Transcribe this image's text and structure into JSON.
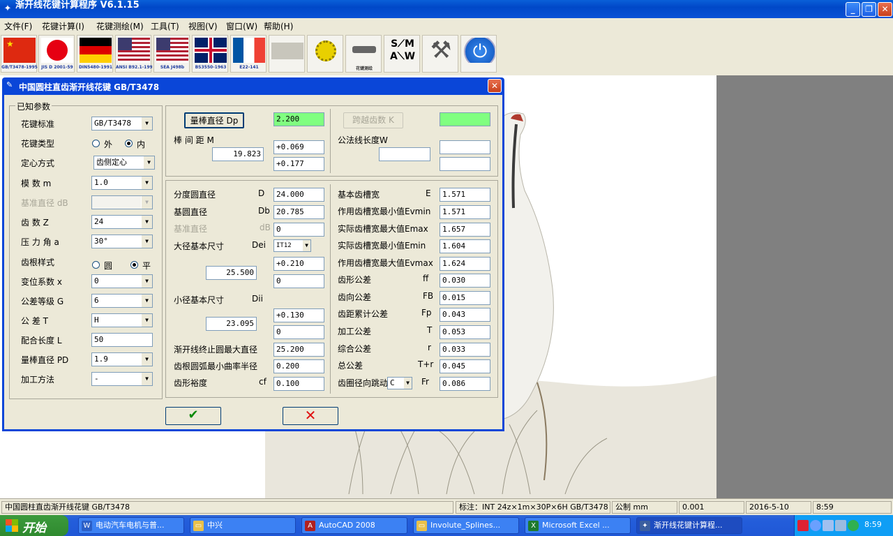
{
  "window": {
    "title": "渐开线花键计算程序      V6.1.15",
    "min": "_",
    "max": "❐",
    "close": "✕"
  },
  "menu": [
    "文件(F)",
    "花键计算(I)",
    "花键测绘(M)",
    "工具(T)",
    "视图(V)",
    "窗口(W)",
    "帮助(H)"
  ],
  "toolbar": [
    {
      "caption": "GB/T3478-1995",
      "icon": "china-flag-icon"
    },
    {
      "caption": "JIS D 2001-59",
      "icon": "japan-flag-icon"
    },
    {
      "caption": "DIN5480-1991",
      "icon": "germany-flag-icon"
    },
    {
      "caption": "ANSI B92.1-1996",
      "icon": "usa-flag-icon"
    },
    {
      "caption": "SEA J498b",
      "icon": "usa-flag-icon"
    },
    {
      "caption": "BS3550-1963",
      "icon": "uk-flag-icon"
    },
    {
      "caption": "E22-141",
      "icon": "france-flag-icon"
    },
    {
      "caption": "",
      "icon": "disabled-tool-icon"
    },
    {
      "caption": "",
      "icon": "gear-puzzle-icon"
    },
    {
      "caption": "花键测绘",
      "icon": "measure-icon"
    },
    {
      "caption": "",
      "icon": "sam-logo-icon"
    },
    {
      "caption": "",
      "icon": "tools-icon"
    },
    {
      "caption": "",
      "icon": "power-icon"
    }
  ],
  "dialog": {
    "title": "中国圆柱直齿渐开线花键   GB/T3478",
    "close": "✕",
    "known_group": "已知参数",
    "params": [
      {
        "label": "花键标准",
        "value": "GB/T3478",
        "type": "combo"
      },
      {
        "label": "花键类型",
        "type": "radio",
        "options": [
          "外",
          "内"
        ],
        "selected": 1
      },
      {
        "label": "定心方式",
        "value": "齿侧定心",
        "type": "combo"
      },
      {
        "label": "模    数  m",
        "value": "1.0",
        "type": "combo"
      },
      {
        "label": "基准直径 dB",
        "value": "",
        "type": "combo",
        "disabled": true
      },
      {
        "label": "齿    数  Z",
        "value": "24",
        "type": "combo"
      },
      {
        "label": "压 力 角  a",
        "value": "30°",
        "type": "combo"
      },
      {
        "label": "齿根样式",
        "type": "radio",
        "options": [
          "圆",
          "平"
        ],
        "selected": 1
      },
      {
        "label": "变位系数  x",
        "value": "0",
        "type": "combo"
      },
      {
        "label": "公差等级  G",
        "value": "6",
        "type": "combo"
      },
      {
        "label": " 公   差  T",
        "value": "H",
        "type": "combo"
      },
      {
        "label": "配合长度  L",
        "value": "50",
        "type": "text"
      },
      {
        "label": "量棒直径 PD",
        "value": "1.9",
        "type": "combo"
      },
      {
        "label": "加工方法",
        "value": "-",
        "type": "combo"
      }
    ],
    "top_left": {
      "btn": "量棒直径 Dp",
      "dp": "2.200",
      "m_label": "棒 间 距  M",
      "m_value": "19.823",
      "tol1": "+0.069",
      "tol2": "+0.177"
    },
    "top_right": {
      "btn": "跨越齿数  K",
      "w_label": "公法线长度W",
      "k_value": "",
      "w_value": "",
      "w_tol1": "",
      "w_tol2": ""
    },
    "mid_left": {
      "d_label": "分度圆直径",
      "d_sym": "D",
      "d_val": "24.000",
      "db_label": "基圆直径",
      "db_sym": "Db",
      "db_val": "20.785",
      "dbase_label": "基准直径",
      "dbase_sym": "dB",
      "dbase_val": "0",
      "dei_label": "大径基本尺寸",
      "dei_sym": "Dei",
      "dei_grade": "IT12",
      "dei_val": "25.500",
      "dei_tol1": "+0.210",
      "dei_tol2": "0",
      "dii_label": "小径基本尺寸",
      "dii_sym": "Dii",
      "dii_val": "23.095",
      "dii_tol1": "+0.130",
      "dii_tol2": "0",
      "dfmax_label": "渐开线终止圆最大直径",
      "dfmax_val": "25.200",
      "rho_label": "齿根圆弧最小曲率半径",
      "rho_val": "0.200",
      "cf_label": "齿形裕度",
      "cf_sym": "cf",
      "cf_val": "0.100"
    },
    "mid_right": [
      {
        "label": "基本齿槽宽",
        "sym": "E",
        "value": "1.571"
      },
      {
        "label": "作用齿槽宽最小值Evmin",
        "sym": "",
        "value": "1.571"
      },
      {
        "label": "实际齿槽宽最大值Emax",
        "sym": "",
        "value": "1.657"
      },
      {
        "label": "实际齿槽宽最小值Emin",
        "sym": "",
        "value": "1.604"
      },
      {
        "label": "作用齿槽宽最大值Evmax",
        "sym": "",
        "value": "1.624"
      },
      {
        "label": "齿形公差",
        "sym": "ff",
        "value": "0.030"
      },
      {
        "label": "齿向公差",
        "sym": "FB",
        "value": "0.015"
      },
      {
        "label": "齿距累计公差",
        "sym": "Fp",
        "value": "0.043"
      },
      {
        "label": "加工公差",
        "sym": "T",
        "value": "0.053"
      },
      {
        "label": "综合公差",
        "sym": "r",
        "value": "0.033"
      },
      {
        "label": "总公差",
        "sym": "T+r",
        "value": "0.045"
      },
      {
        "label": "齿圈径向跳动",
        "sym": "Fr",
        "value": "0.086",
        "combo": "C"
      }
    ],
    "ok": "✔",
    "cancel": "✕"
  },
  "status": {
    "left": "中国圆柱直齿渐开线花键   GB/T3478",
    "mark": "标注：INT 24z×1m×30P×6H GB/T3478",
    "unit": "公制 mm",
    "prec": "0.001",
    "date": "2016-5-10",
    "time": "8:59"
  },
  "taskbar": {
    "start": "开始",
    "tasks": [
      {
        "label": "电动汽车电机与普...",
        "icon": "W",
        "color": "#2b5fc7"
      },
      {
        "label": "中兴",
        "icon": "▭",
        "color": "#e8c04a"
      },
      {
        "label": "AutoCAD 2008",
        "icon": "A",
        "color": "#b02020"
      },
      {
        "label": "Involute_Splines...",
        "icon": "▭",
        "color": "#e8c04a"
      },
      {
        "label": "Microsoft Excel ...",
        "icon": "X",
        "color": "#1e7a2e"
      },
      {
        "label": "渐开线花键计算程...",
        "icon": "✦",
        "color": "#3b5fa0"
      }
    ],
    "clock": "8:59"
  },
  "colors": {
    "accent_green": "#80ff80",
    "title_blue": "#0a46d8"
  }
}
